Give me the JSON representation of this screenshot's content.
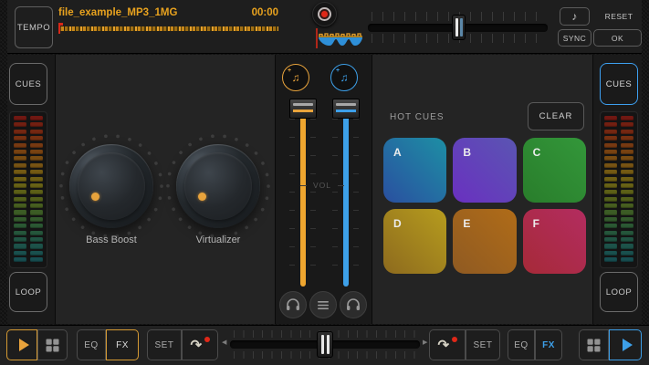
{
  "topbar": {
    "tempo_label": "TEMPO",
    "track_title": "file_example_MP3_1MG",
    "track_time": "00:00",
    "reset_label": "RESET",
    "sync_label": "SYNC",
    "ok_label": "OK"
  },
  "side_left": {
    "cues_label": "CUES",
    "loop_label": "LOOP"
  },
  "side_right": {
    "cues_label": "CUES",
    "loop_label": "LOOP"
  },
  "deck_a": {
    "knobs": [
      {
        "label": "Bass Boost"
      },
      {
        "label": "Virtualizer"
      }
    ]
  },
  "mixer": {
    "vol_label": "VOL"
  },
  "deck_b": {
    "hot_cues_label": "HOT CUES",
    "clear_label": "CLEAR",
    "pads": [
      {
        "label": "A",
        "color_from": "#1d8fa4",
        "color_to": "#2a4fa0"
      },
      {
        "label": "B",
        "color_from": "#5a55b2",
        "color_to": "#6a30c0"
      },
      {
        "label": "C",
        "color_from": "#33973a",
        "color_to": "#297d2b"
      },
      {
        "label": "D",
        "color_from": "#b69c1e",
        "color_to": "#8d6a1e"
      },
      {
        "label": "E",
        "color_from": "#b06c18",
        "color_to": "#8f5a22"
      },
      {
        "label": "F",
        "color_from": "#b32c60",
        "color_to": "#a62a38"
      }
    ]
  },
  "bottombar": {
    "left": {
      "eq_label": "EQ",
      "fx_label": "FX",
      "set_label": "SET"
    },
    "right": {
      "eq_label": "EQ",
      "fx_label": "FX",
      "set_label": "SET"
    }
  },
  "meters": {
    "led_colors": [
      "#701812",
      "#721f11",
      "#742711",
      "#763011",
      "#773911",
      "#784211",
      "#784b12",
      "#775313",
      "#745a13",
      "#6f5f14",
      "#676115",
      "#5d6017",
      "#525f1a",
      "#475e1f",
      "#3c5c25",
      "#335a2c",
      "#2b5833",
      "#25563b",
      "#205443",
      "#1c5249",
      "#19504e",
      "#174e51"
    ]
  },
  "icons": {
    "record": "record-dot",
    "music_note": "♪",
    "music_note_double": "♫",
    "plus": "+",
    "curved_arrow": "↷",
    "arrow_left": "◀",
    "arrow_right": "▶",
    "headphones": "headphones",
    "menu": "menu-lines",
    "grid": "grid-squares",
    "play": "triangle"
  },
  "colors": {
    "accent_orange": "#e8a33c",
    "accent_blue": "#3d9fe8",
    "record_red": "#e02818",
    "title_orange": "#e8a21e"
  }
}
